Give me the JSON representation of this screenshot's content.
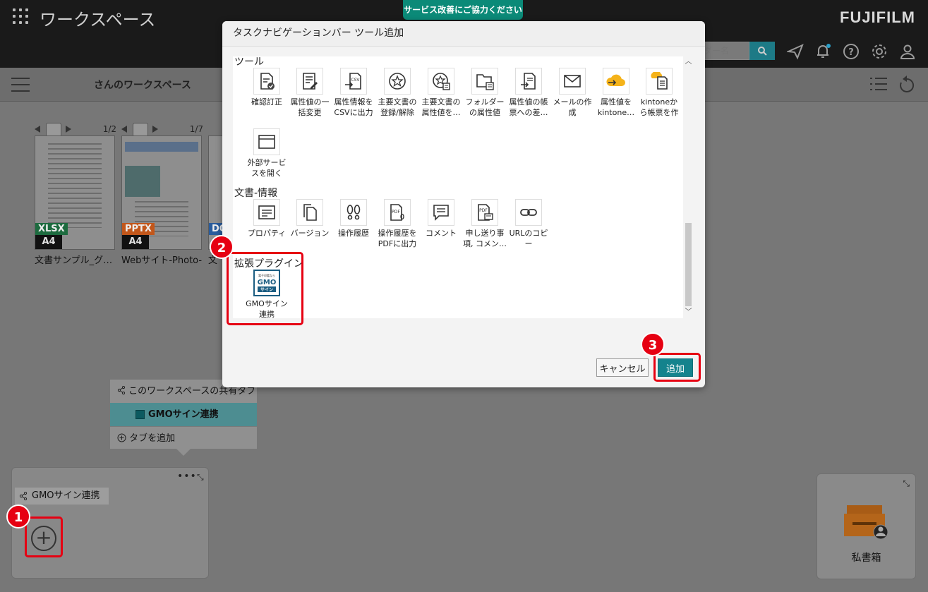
{
  "header": {
    "app_title": "ワークスペース",
    "survey_banner": "サービス改善にご協力ください",
    "brand": "FUJIFILM",
    "search_placeholder": "ダー名",
    "icons": [
      "grid-icon",
      "search-icon",
      "send-icon",
      "bell-icon",
      "help-icon",
      "gear-icon",
      "user-icon"
    ],
    "accent_color": "#1d7a86"
  },
  "workspace": {
    "name": "さんのワークスペース"
  },
  "documents": [
    {
      "page": "1/2",
      "type": "XLSX",
      "type_color": "#1d6b3f",
      "size": "A4",
      "name": "文書サンプル_グ…"
    },
    {
      "page": "1/7",
      "type": "PPTX",
      "type_color": "#c2571b",
      "size": "A4",
      "name": "Webサイト-Photo-"
    },
    {
      "page": "",
      "type": "DO",
      "type_color": "#2a5c9c",
      "size": "",
      "name": "文"
    }
  ],
  "shared_tabs": {
    "header": "このワークスペースの共有タブ",
    "selected_tab": "GMOサイン連携",
    "add_tab": "タブを追加"
  },
  "tray": {
    "tab_label": "GMOサイン連携"
  },
  "mybox": {
    "label": "私書箱"
  },
  "modal": {
    "title": "タスクナビゲーションバー ツール追加",
    "sections": [
      {
        "name": "ツール",
        "tools": [
          {
            "label": "確認訂正",
            "icon": "check-doc-icon"
          },
          {
            "label": "属性値の一括変更",
            "icon": "bulk-edit-icon"
          },
          {
            "label": "属性情報をCSVに出力",
            "icon": "csv-export-icon"
          },
          {
            "label": "主要文書の登録/解除",
            "icon": "star-icon"
          },
          {
            "label": "主要文書の属性値を…",
            "icon": "star-doc-icon"
          },
          {
            "label": "フォルダーの属性値を…",
            "icon": "folder-icon"
          },
          {
            "label": "属性値の帳票への差…",
            "icon": "form-insert-icon"
          },
          {
            "label": "メールの作成",
            "icon": "mail-icon"
          },
          {
            "label": "属性値をkintone…",
            "icon": "kintone-cloud-icon"
          },
          {
            "label": "kintoneから帳票を作成",
            "icon": "kintone-form-icon"
          },
          {
            "label": "外部サービスを開く",
            "icon": "window-icon"
          }
        ]
      },
      {
        "name": "文書-情報",
        "tools": [
          {
            "label": "プロパティ",
            "icon": "property-icon"
          },
          {
            "label": "バージョン",
            "icon": "version-icon"
          },
          {
            "label": "操作履歴",
            "icon": "footprint-icon"
          },
          {
            "label": "操作履歴をPDFに出力",
            "icon": "pdf-export-icon"
          },
          {
            "label": "コメント",
            "icon": "comment-icon"
          },
          {
            "label": "申し送り事項, コメン…",
            "icon": "pdf-comment-icon"
          },
          {
            "label": "URLのコピー",
            "icon": "link-icon"
          }
        ]
      },
      {
        "name": "拡張プラグイン",
        "tools": [
          {
            "label": "GMOサイン連携",
            "icon": "gmo-sign-logo",
            "logo_text": "GMO",
            "logo_sub": "サイン",
            "logo_top": "電子印鑑なら"
          }
        ]
      }
    ],
    "cancel_label": "キャンセル",
    "add_label": "追加"
  },
  "markers": [
    "1",
    "2",
    "3"
  ],
  "highlight_color": "#e60012"
}
